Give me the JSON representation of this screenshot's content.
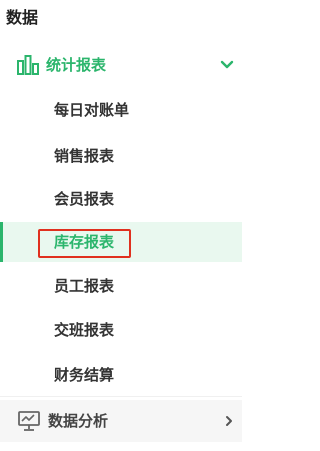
{
  "section": {
    "title": "数据"
  },
  "group": {
    "label": "统计报表",
    "icon": "bar-chart-icon",
    "expanded": true,
    "accent_color": "#2bb56c"
  },
  "items": [
    {
      "label": "每日对账单",
      "active": false
    },
    {
      "label": "销售报表",
      "active": false
    },
    {
      "label": "会员报表",
      "active": false
    },
    {
      "label": "库存报表",
      "active": true,
      "highlighted": true
    },
    {
      "label": "员工报表",
      "active": false
    },
    {
      "label": "交班报表",
      "active": false
    },
    {
      "label": "财务结算",
      "active": false
    }
  ],
  "group2": {
    "label": "数据分析",
    "icon": "monitor-chart-icon",
    "expanded": false
  },
  "colors": {
    "active_bg": "#e9f8ef",
    "highlight_border": "#e0301e"
  }
}
